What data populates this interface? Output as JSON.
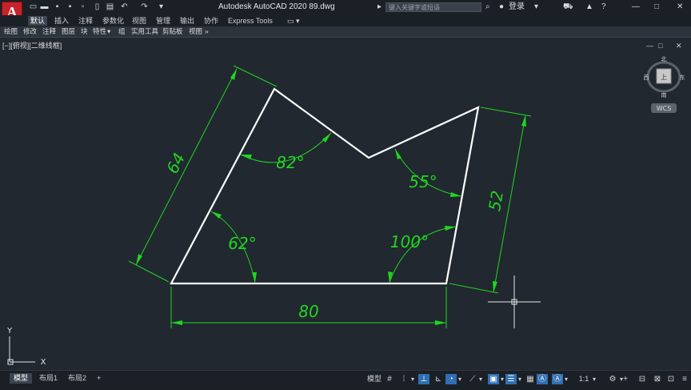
{
  "app": {
    "logo": "A",
    "title": "Autodesk AutoCAD 2020    89.dwg",
    "search_placeholder": "键入关键字或短语",
    "login": "登录",
    "window_controls": [
      "—",
      "□",
      "✕"
    ]
  },
  "quick_access": [
    "new-icon",
    "open-icon",
    "save-icon",
    "saveas-icon",
    "plot-icon",
    "undo-icon",
    "redo-icon"
  ],
  "ribbon_tabs": [
    "默认",
    "插入",
    "注释",
    "参数化",
    "视图",
    "管理",
    "输出",
    "协作",
    "Express Tools"
  ],
  "panels": [
    "绘图",
    "修改",
    "注释",
    "图层",
    "块",
    "特性",
    "组",
    "实用工具",
    "剪贴板",
    "视图"
  ],
  "viewport": {
    "label": "[−][俯视][二维线框]",
    "window_controls": [
      "—",
      "□",
      "✕"
    ]
  },
  "viewcube": {
    "north": "北",
    "south": "南",
    "east": "东",
    "west": "西",
    "face": "上",
    "wcs": "WCS"
  },
  "ucs": {
    "x": "X",
    "y": "Y"
  },
  "drawing": {
    "line_color": "#ffffff",
    "dim_color": "#1fd61f",
    "dims": {
      "bottom": "80",
      "left": "64",
      "right": "52"
    },
    "angles": {
      "a1": "82°",
      "a2": "55°",
      "a3": "62°",
      "a4": "100°"
    }
  },
  "layout_tabs": [
    "模型",
    "布局1",
    "布局2"
  ],
  "add_tab": "+",
  "status": {
    "model": "模型",
    "scale": "1:1"
  }
}
